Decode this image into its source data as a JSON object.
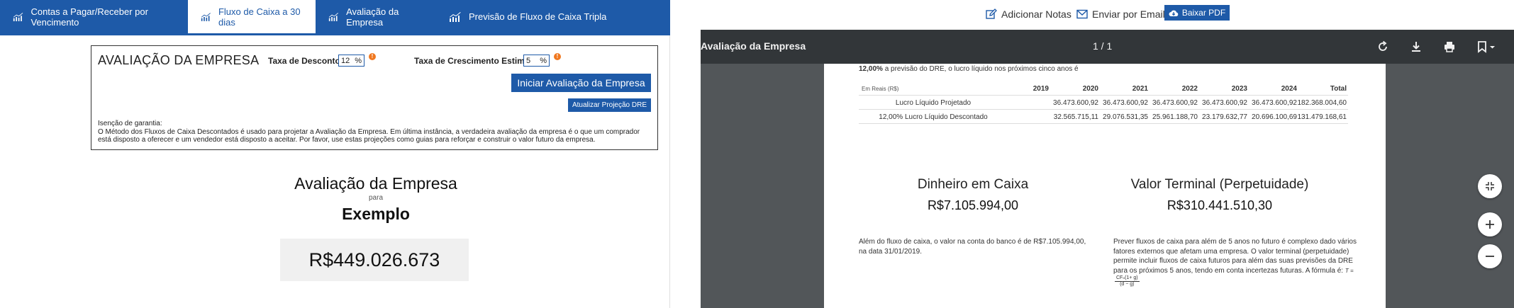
{
  "tabs": [
    {
      "label": "Contas a Pagar/Receber por Vencimento",
      "active": false
    },
    {
      "label": "Fluxo de Caixa a 30 dias",
      "active": true
    },
    {
      "label": "Avaliação da Empresa",
      "active": false
    },
    {
      "label": "Previsão de Fluxo de Caixa Tripla",
      "active": false
    }
  ],
  "form": {
    "title": "AVALIAÇÃO DA EMPRESA",
    "discount_label": "Taxa de Desconto",
    "discount_value": "12",
    "growth_label": "Taxa de Crescimento Estimada",
    "growth_value": "5",
    "percent": "%",
    "info_glyph": "!",
    "start_button": "Iniciar Avaliação da Empresa",
    "update_button": "Atualizar Projeção DRE",
    "disclaimer_title": "Isenção de garantia:",
    "disclaimer_text": "O Método dos Fluxos de Caixa Descontados é usado para projetar a Avaliação da Empresa. Em última instância, a verdadeira avaliação da empresa é o que um comprador está disposto a oferecer e um vendedor está disposto a aceitar. Por favor, use estas projeções como guias para reforçar e construir o valor futuro da empresa."
  },
  "valuation": {
    "title": "Avaliação da Empresa",
    "for": "para",
    "company": "Exemplo",
    "value": "R$449.026.673"
  },
  "toolbar": {
    "add_notes": "Adicionar Notas",
    "send_email": "Enviar por Email",
    "download_pdf": "Baixar PDF"
  },
  "viewer": {
    "title": "Avaliação da Empresa",
    "pages": "1  /  1",
    "intro_bold": "12,00%",
    "intro_rest": " a previsão do DRE, o lucro líquido nos próximos cinco anos é",
    "table": {
      "unit": "Em Reais (R$)",
      "headers": [
        "2019",
        "2020",
        "2021",
        "2022",
        "2023",
        "2024",
        "Total"
      ],
      "rows": [
        {
          "label": "Lucro Líquido Projetado",
          "values": [
            "",
            "36.473.600,92",
            "36.473.600,92",
            "36.473.600,92",
            "36.473.600,92",
            "36.473.600,92",
            "182.368.004,60"
          ]
        },
        {
          "label": "12,00% Lucro Líquido Descontado",
          "values": [
            "",
            "32.565.715,11",
            "29.076.531,35",
            "25.961.188,70",
            "23.179.632,77",
            "20.696.100,69",
            "131.479.168,61"
          ]
        }
      ]
    },
    "cash_title": "Dinheiro em Caixa",
    "cash_value": "R$7.105.994,00",
    "terminal_title": "Valor Terminal (Perpetuidade)",
    "terminal_value": "R$310.441.510,30",
    "cash_text": "Além do fluxo de caixa, o valor na conta do banco é de R$7.105.994,00, na data 31/01/2019.",
    "terminal_text": "Prever fluxos de caixa para além de 5 anos no futuro é complexo dado vários fatores externos que afetam uma empresa. O valor terminal (perpetuidade) permite incluir fluxos de caixa futuros para além das suas previsões da DRE para os próximos 5 anos, tendo em conta incertezas futuras. A fórmula é:",
    "formula_lhs": "T =",
    "formula_num": "CFₙ(1+ g)",
    "formula_den": "(d − g)"
  },
  "colors": {
    "brand_blue": "#1e5aa8",
    "info_orange": "#f07820",
    "viewer_bar": "#323639",
    "viewer_bg": "#525659"
  }
}
